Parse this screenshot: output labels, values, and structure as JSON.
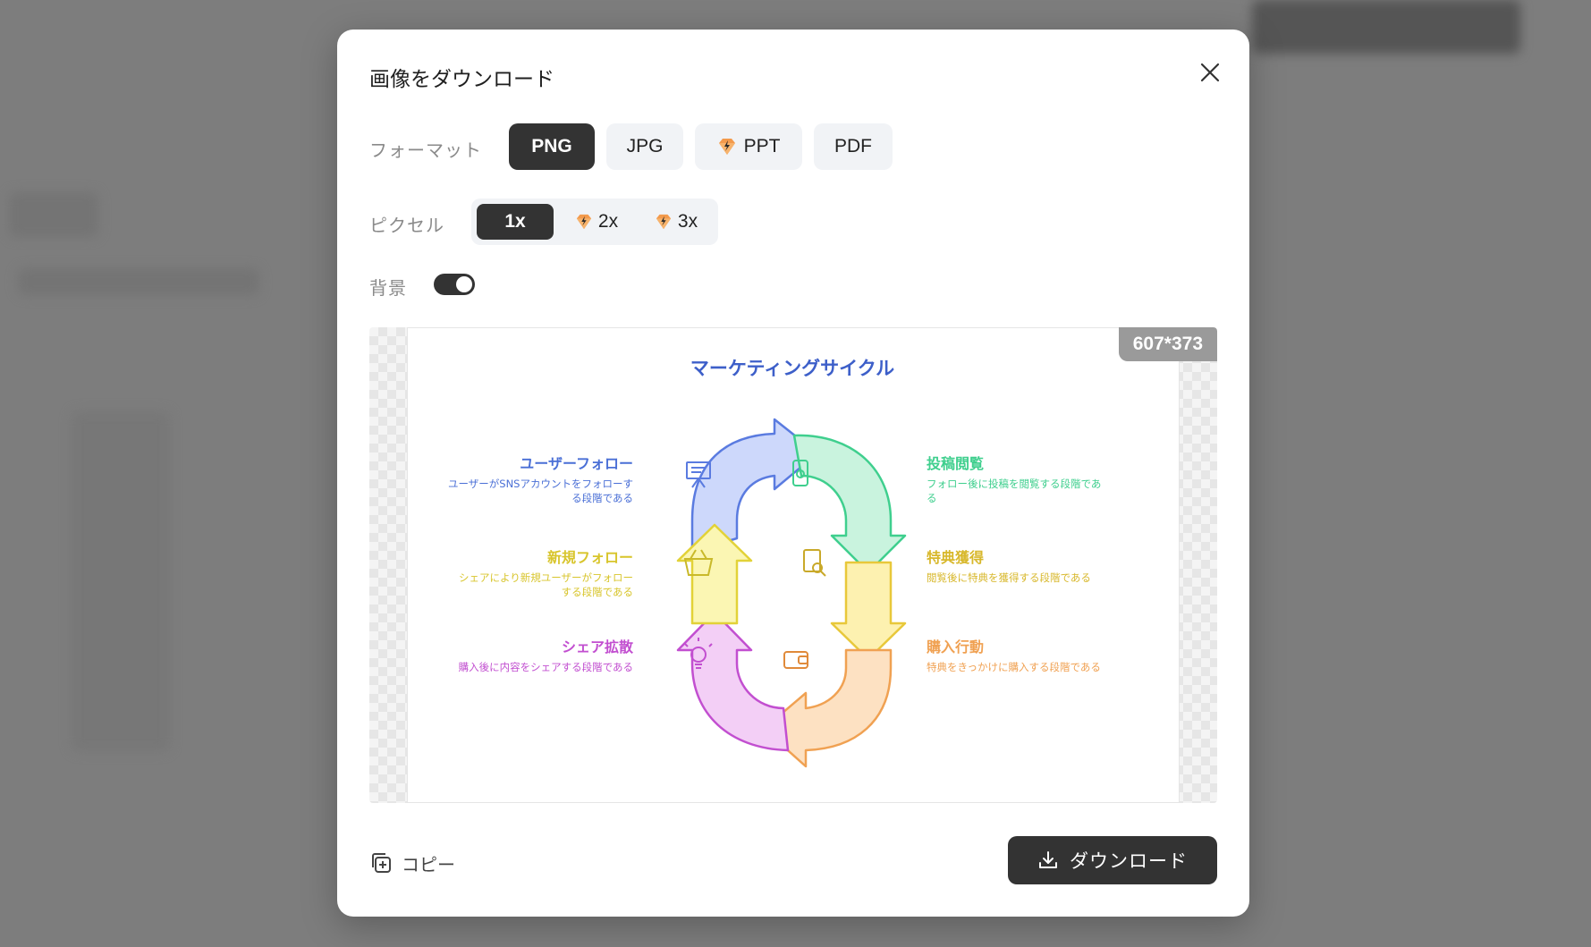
{
  "dialog": {
    "title": "画像をダウンロード"
  },
  "format": {
    "label": "フォーマット",
    "options": [
      "PNG",
      "JPG",
      "PPT",
      "PDF"
    ],
    "selected": "PNG",
    "premium": [
      "PPT"
    ]
  },
  "pixel": {
    "label": "ピクセル",
    "options": [
      "1x",
      "2x",
      "3x"
    ],
    "selected": "1x",
    "premium": [
      "2x",
      "3x"
    ]
  },
  "background": {
    "label": "背景",
    "enabled": true
  },
  "preview": {
    "size_label": "607*373",
    "infographic": {
      "title": "マーケティングサイクル",
      "stages": [
        {
          "title": "ユーザーフォロー",
          "desc_lines": [
            "ユーザーがSNSアカウントをフォローす",
            "る段階である"
          ],
          "color": "#4a6fd6",
          "icon": "presentation-board-icon"
        },
        {
          "title": "投稿閲覧",
          "desc_lines": [
            "フォロー後に投稿を閲覧する段階であ",
            "る"
          ],
          "color": "#3fcf8e",
          "icon": "smartphone-icon"
        },
        {
          "title": "特典獲得",
          "desc_lines": [
            "閲覧後に特典を獲得する段階である"
          ],
          "color": "#e8c83a",
          "icon": "document-search-icon"
        },
        {
          "title": "購入行動",
          "desc_lines": [
            "特典をきっかけに購入する段階である"
          ],
          "color": "#f0a152",
          "icon": "wallet-icon"
        },
        {
          "title": "シェア拡散",
          "desc_lines": [
            "購入後に内容をシェアする段階である"
          ],
          "color": "#c24fd0",
          "icon": "lightbulb-icon"
        },
        {
          "title": "新規フォロー",
          "desc_lines": [
            "シェアにより新規ユーザーがフォロー",
            "する段階である"
          ],
          "color": "#e2d238",
          "icon": "basket-icon"
        }
      ]
    }
  },
  "actions": {
    "copy_label": "コピー",
    "download_label": "ダウンロード"
  },
  "colors": {
    "accent_dark": "#333333",
    "chip_bg": "#f1f3f6",
    "premium_gem": "#f39a4c"
  }
}
